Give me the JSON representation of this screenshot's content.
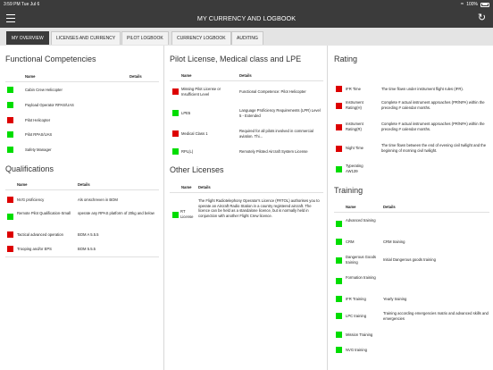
{
  "status_bar": {
    "time": "3:59 PM  Tue Jul 6",
    "battery": "100%"
  },
  "nav": {
    "title": "MY CURRENCY AND LOGBOOK",
    "menu_icon": "hamburger-icon",
    "refresh_icon": "refresh-icon"
  },
  "tabs": [
    {
      "label": "MY OVERVIEW",
      "active": true
    },
    {
      "label": "LICENSES AND CURRENCY"
    },
    {
      "label": "PILOT LOGBOOK"
    },
    {
      "label": "CURRENCY LOGBOOK"
    },
    {
      "label": "AUDITING"
    }
  ],
  "colors": {
    "ok": "#00dd00",
    "expired": "#dd0000",
    "header_bg": "#3b3b3b"
  },
  "functional_competencies": {
    "title": "Functional Competencies",
    "headers": {
      "name": "Name",
      "details": "Details"
    },
    "rows": [
      {
        "status": "green",
        "name": "Cabin Crew Helicopter",
        "details": ""
      },
      {
        "status": "green",
        "name": "Payload Operator RPAS/UAS",
        "details": ""
      },
      {
        "status": "red",
        "name": "Pilot Helicopter",
        "details": ""
      },
      {
        "status": "green",
        "name": "Pilot RPAS/UAS",
        "details": ""
      },
      {
        "status": "green",
        "name": "Safety Manager",
        "details": ""
      }
    ]
  },
  "qualifications": {
    "title": "Qualifications",
    "headers": {
      "name": "Name",
      "details": "Details"
    },
    "rows": [
      {
        "status": "red",
        "name": "NVG proficiency",
        "details": "Als omschreven in BOM"
      },
      {
        "status": "green",
        "name": "Remote Pilot Qualification-Small",
        "details": "operate any RPAS platform of 20kg and below"
      },
      {
        "status": "red",
        "name": "Tactical advanced operation",
        "details": "BOM A 5.5.5"
      },
      {
        "status": "red",
        "name": "Trooping and/or EPS",
        "details": "BOM 5.5.5"
      }
    ]
  },
  "pilot_license": {
    "title": "Pilot License, Medical class and LPE",
    "headers": {
      "name": "Name",
      "details": "Details"
    },
    "rows": [
      {
        "status": "red",
        "name": "Missing Pilot License or Insufficient Level",
        "details": "Functional Competence: Pilot Helicopter"
      },
      {
        "status": "green",
        "name": "LPE5",
        "details": "Language Proficiency Requirements (LPR) Level 5 - Extended"
      },
      {
        "status": "red",
        "name": "Medical Class 1",
        "details": "Required for all pilots involved in commercial aviation. Thi..."
      },
      {
        "status": "green",
        "name": "RPL(L)",
        "details": "Remotely Piloted Aircraft System License"
      }
    ]
  },
  "other_licenses": {
    "title": "Other Licenses",
    "headers": {
      "name": "Name",
      "details": "Details"
    },
    "rows": [
      {
        "status": "green",
        "name": "RT License",
        "details": "The Flight Radiotelephony Operator's Licence (FRTOL) authorises you to operate an Aircraft Radio Station in a country registered aircraft. The licence can be held as a standalone licence, but is normally held in conjunction with another Flight Crew licence."
      }
    ]
  },
  "rating": {
    "title": "Rating",
    "rows": [
      {
        "status": "red",
        "name": "IFR Time",
        "details": "The time flown under instrument flight rules (IFR)."
      },
      {
        "status": "red",
        "name": "Instrument Rating(H)",
        "details": "Complete # actual instrument approaches (PR/NPA) within the preceding # calendar months."
      },
      {
        "status": "red",
        "name": "Instrument Rating(R)",
        "details": "Complete # actual instrument approaches (PR/NPA) within the preceding # calendar months."
      },
      {
        "status": "red",
        "name": "Night Time",
        "details": "The time flown between the end of evening civil twilight and the beginning of morning civil twilight."
      },
      {
        "status": "green",
        "name": "Typerating AW139",
        "details": ""
      }
    ]
  },
  "training": {
    "title": "Training",
    "headers": {
      "name": "Name",
      "details": "Details"
    },
    "rows": [
      {
        "status": "green",
        "name": "Advanced training",
        "details": ""
      },
      {
        "status": "green",
        "name": "CRM",
        "details": "CRM training"
      },
      {
        "status": "green",
        "name": "Dangerous Goods training",
        "details": "Initial Dangerous goods training"
      },
      {
        "status": "green",
        "name": "Formation training",
        "details": ""
      },
      {
        "status": "green",
        "name": "IFR Training",
        "details": "Yearly training"
      },
      {
        "status": "green",
        "name": "LPC training",
        "details": "Training according emergencies matrix and advanced skills and emergencies"
      },
      {
        "status": "green",
        "name": "Mission Training",
        "details": ""
      },
      {
        "status": "green",
        "name": "NVG training",
        "details": ""
      }
    ]
  }
}
